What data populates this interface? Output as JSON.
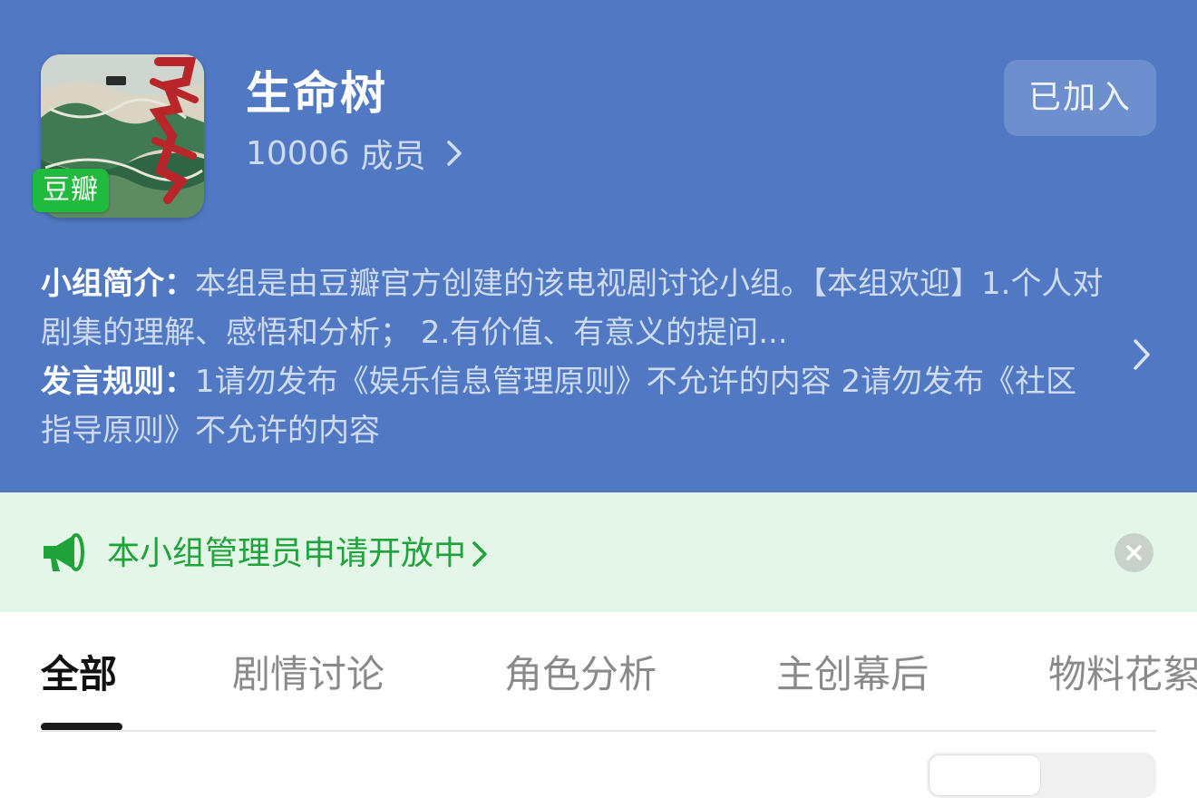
{
  "group": {
    "name": "生命树",
    "members_count": "10006",
    "members_label": "成员",
    "badge": "豆瓣",
    "join_label": "已加入"
  },
  "info": {
    "intro_label": "小组简介：",
    "intro_text": "本组是由豆瓣官方创建的该电视剧讨论小组。【本组欢迎】1.个人对剧集的理解、感悟和分析； 2.有价值、有意义的提问...",
    "rules_label": "发言规则：",
    "rules_text": "1请勿发布《娱乐信息管理原则》不允许的内容 2请勿发布《社区指导原则》不允许的内容"
  },
  "notice": {
    "text": "本小组管理员申请开放中"
  },
  "tabs": [
    {
      "label": "全部",
      "active": true
    },
    {
      "label": "剧情讨论",
      "active": false
    },
    {
      "label": "角色分析",
      "active": false
    },
    {
      "label": "主创幕后",
      "active": false
    },
    {
      "label": "物料花絮",
      "active": false
    }
  ],
  "colors": {
    "header_bg": "#5179c3",
    "notice_bg": "#e4f6e8",
    "notice_text": "#1fa33a",
    "badge_green": "#1fba3e"
  },
  "icons": {
    "members_chevron": "chevron-right-icon",
    "info_chevron": "chevron-right-icon",
    "notice_icon": "megaphone-icon",
    "close_icon": "close-icon"
  }
}
